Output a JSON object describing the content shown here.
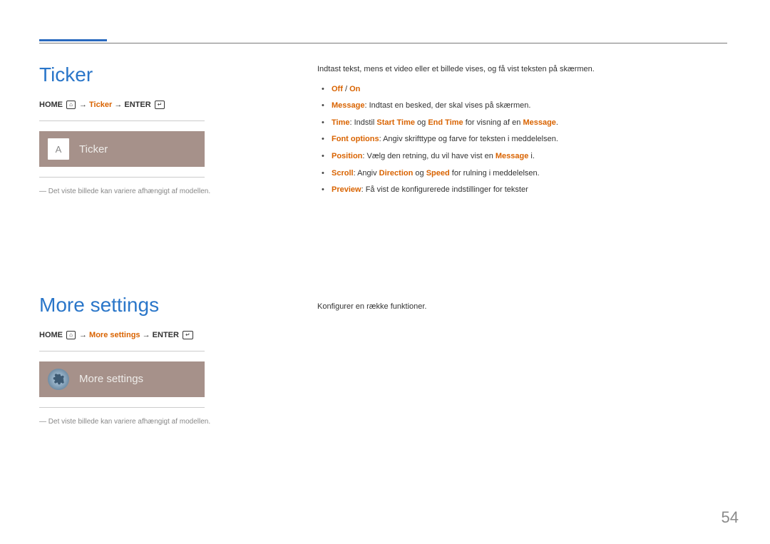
{
  "page_number": "54",
  "sections": [
    {
      "title": "Ticker",
      "breadcrumb": {
        "home": "HOME",
        "arrow": "→",
        "hl": "Ticker",
        "enter": "ENTER"
      },
      "tile": {
        "label": "Ticker",
        "icon_text": "A"
      },
      "footnote": "Det viste billede kan variere afhængigt af modellen.",
      "right": {
        "intro": "Indtast tekst, mens et video eller et billede vises, og få vist teksten på skærmen.",
        "items": [
          {
            "lead": "Off",
            "sep": " / ",
            "lead2": "On",
            "rest": ""
          },
          {
            "lead": "Message",
            "rest": ": Indtast en besked, der skal vises på skærmen."
          },
          {
            "lead": "Time",
            "rest_pre": ": Indstil ",
            "hl1": "Start Time",
            "mid": " og ",
            "hl2": "End Time",
            "rest_post": " for visning af en ",
            "hl3": "Message",
            "tail": "."
          },
          {
            "lead": "Font options",
            "rest": ": Angiv skrifttype og farve for teksten i meddelelsen."
          },
          {
            "lead": "Position",
            "rest_pre": ": Vælg den retning, du vil have vist en ",
            "hl1": "Message",
            "tail": " i."
          },
          {
            "lead": "Scroll",
            "rest_pre": ": Angiv ",
            "hl1": "Direction",
            "mid": " og ",
            "hl2": "Speed",
            "tail": " for rulning i meddelelsen."
          },
          {
            "lead": "Preview",
            "rest": ": Få vist de konfigurerede indstillinger for tekster"
          }
        ]
      }
    },
    {
      "title": "More settings",
      "breadcrumb": {
        "home": "HOME",
        "arrow": "→",
        "hl": "More settings",
        "enter": "ENTER"
      },
      "tile": {
        "label": "More settings"
      },
      "footnote": "Det viste billede kan variere afhængigt af modellen.",
      "right": {
        "intro": "Konfigurer en række funktioner."
      }
    }
  ]
}
